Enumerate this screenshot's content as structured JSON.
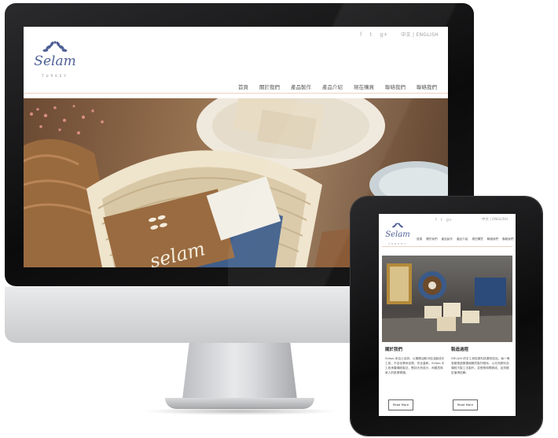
{
  "desktop": {
    "logo_text": "Selam",
    "logo_sub": "TURKEY",
    "social": [
      "f",
      "t",
      "g+"
    ],
    "language": "中文 | ENGLISH",
    "nav": [
      "首頁",
      "關於我們",
      "產品製作",
      "產品介紹",
      "現在購買",
      "聯絡我們",
      "聯絡我們"
    ],
    "hero_image": "soap-basket-photo"
  },
  "tablet": {
    "logo_text": "Selam",
    "logo_sub": "TURKEY",
    "social": [
      "f",
      "t",
      "g+"
    ],
    "language": "中文 | ENGLISH",
    "nav": [
      "首頁",
      "關於我們",
      "產品製作",
      "產品介紹",
      "現在購買",
      "聯絡我們",
      "聯絡我們"
    ],
    "hero_image": "soap-still-life-photo",
    "columns": [
      {
        "title": "關於我們",
        "body": "Selam 來自土耳其，以橄欖油和月桂油製成手工皂，不含化學添加物，安全溫和。Selam 手工皂承襲傳統製法，堅持天然成分，呵護您與家人的肌膚健康。",
        "button": "Read More"
      },
      {
        "title": "製造過程",
        "body": "SELAM 的手工皂從原料挑選到成品，每一塊皂都經過繁複細緻的製作程序，以天然原料及傳統冷製工法製作，並經長時間熟成，品質穩定值得信賴。",
        "button": "Read More"
      }
    ]
  }
}
